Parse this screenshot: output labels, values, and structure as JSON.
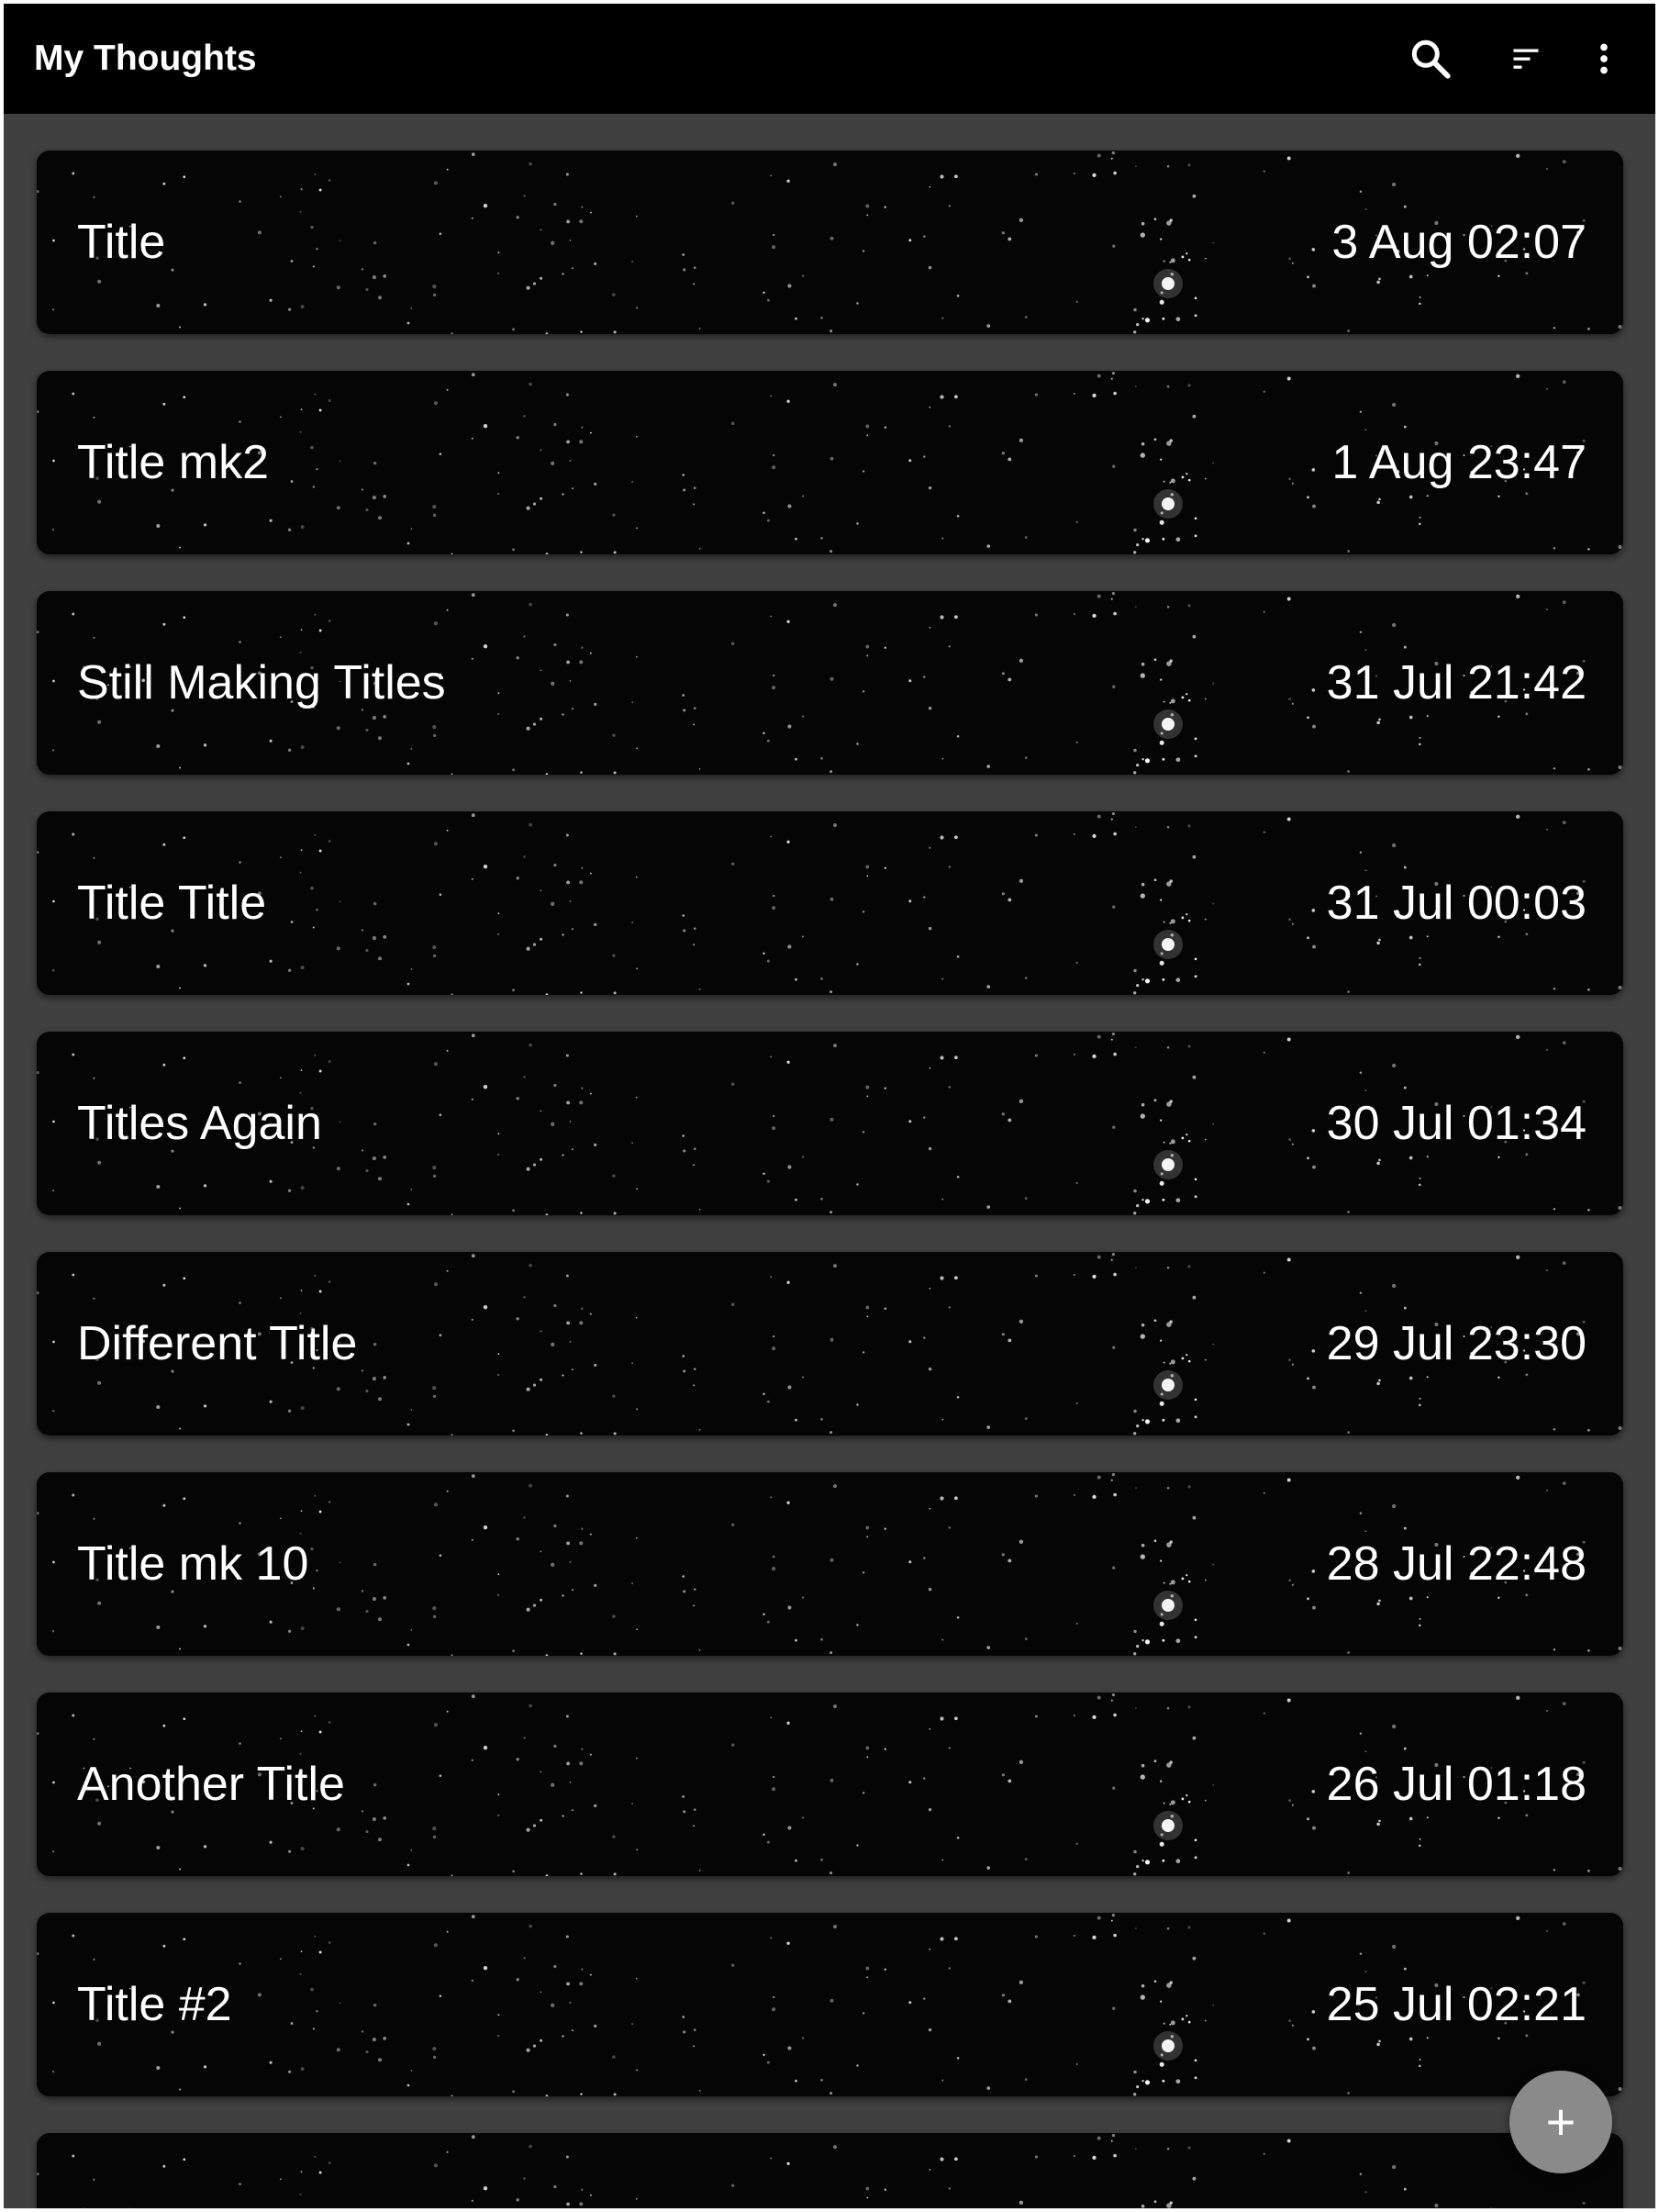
{
  "app": {
    "title": "My Thoughts",
    "actions": {
      "search": "search-icon",
      "sort": "sort-icon",
      "more": "more-vert-icon"
    }
  },
  "colors": {
    "appbar": "#000000",
    "background": "#404040",
    "card": "#050505",
    "text": "#ffffff",
    "fab": "#8a8a8a"
  },
  "notes": [
    {
      "title": "Title",
      "date": "3 Aug 02:07"
    },
    {
      "title": "Title mk2",
      "date": "1 Aug 23:47"
    },
    {
      "title": "Still Making Titles",
      "date": "31 Jul 21:42"
    },
    {
      "title": "Title Title",
      "date": "31 Jul 00:03"
    },
    {
      "title": "Titles Again",
      "date": "30 Jul 01:34"
    },
    {
      "title": "Different Title",
      "date": "29 Jul 23:30"
    },
    {
      "title": "Title mk 10",
      "date": "28 Jul 22:48"
    },
    {
      "title": "Another Title",
      "date": "26 Jul 01:18"
    },
    {
      "title": "Title #2",
      "date": "25 Jul 02:21"
    },
    {
      "title": "",
      "date": ""
    }
  ],
  "fab": {
    "label": "+",
    "icon": "add-icon"
  }
}
